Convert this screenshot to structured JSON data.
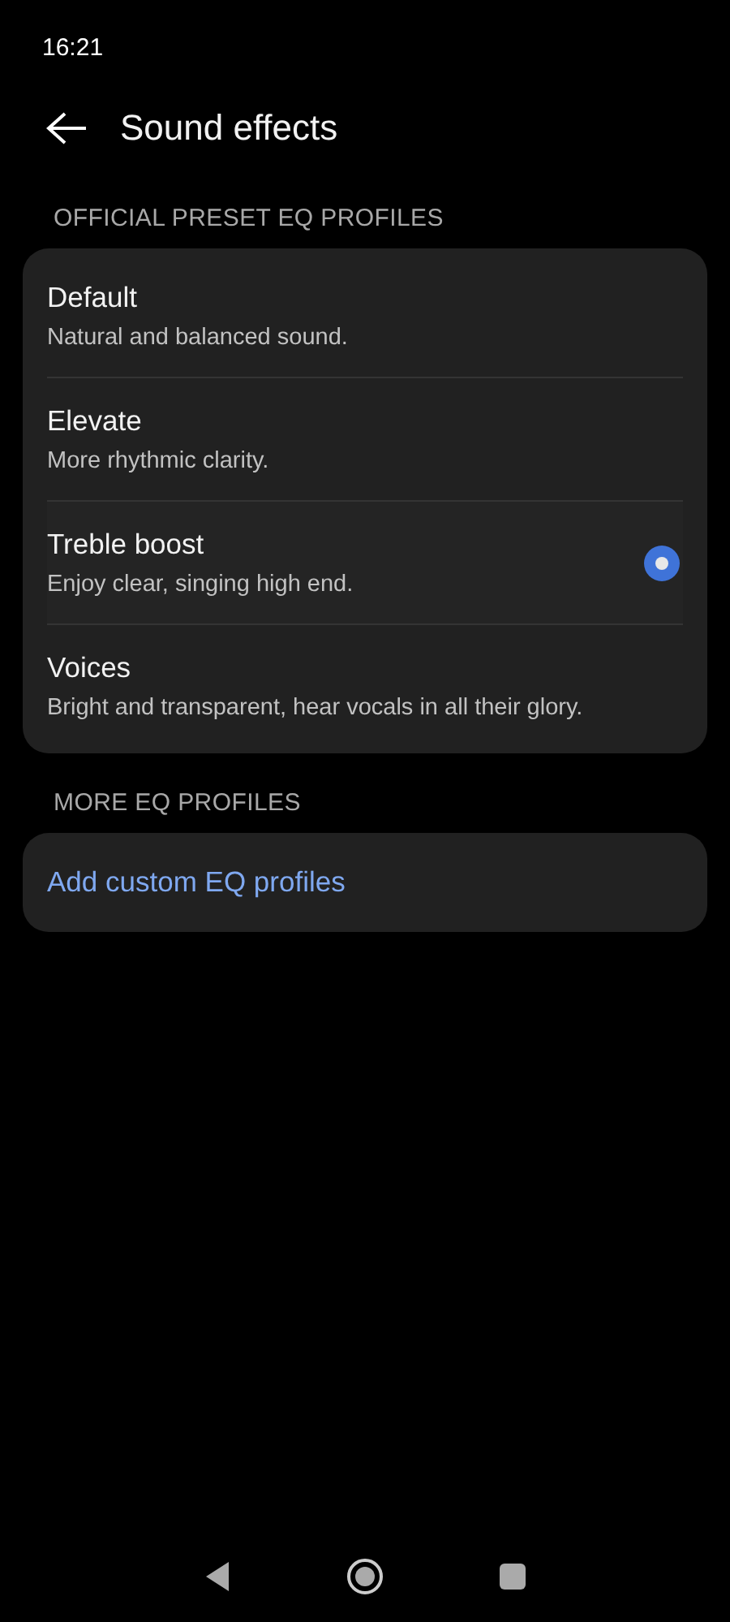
{
  "status_bar": {
    "time": "16:21"
  },
  "header": {
    "title": "Sound effects"
  },
  "sections": [
    {
      "heading": "OFFICIAL PRESET EQ PROFILES",
      "items": [
        {
          "kind": "option",
          "title": "Default",
          "subtitle": "Natural and balanced sound.",
          "selected": false
        },
        {
          "kind": "option",
          "title": "Elevate",
          "subtitle": "More rhythmic clarity.",
          "selected": false
        },
        {
          "kind": "option",
          "title": "Treble boost",
          "subtitle": "Enjoy clear, singing high end.",
          "selected": true
        },
        {
          "kind": "option",
          "title": "Voices",
          "subtitle": "Bright and transparent, hear vocals in all their glory.",
          "selected": false
        }
      ]
    },
    {
      "heading": "MORE EQ PROFILES",
      "items": [
        {
          "kind": "link",
          "title": "Add custom EQ profiles"
        }
      ]
    }
  ]
}
